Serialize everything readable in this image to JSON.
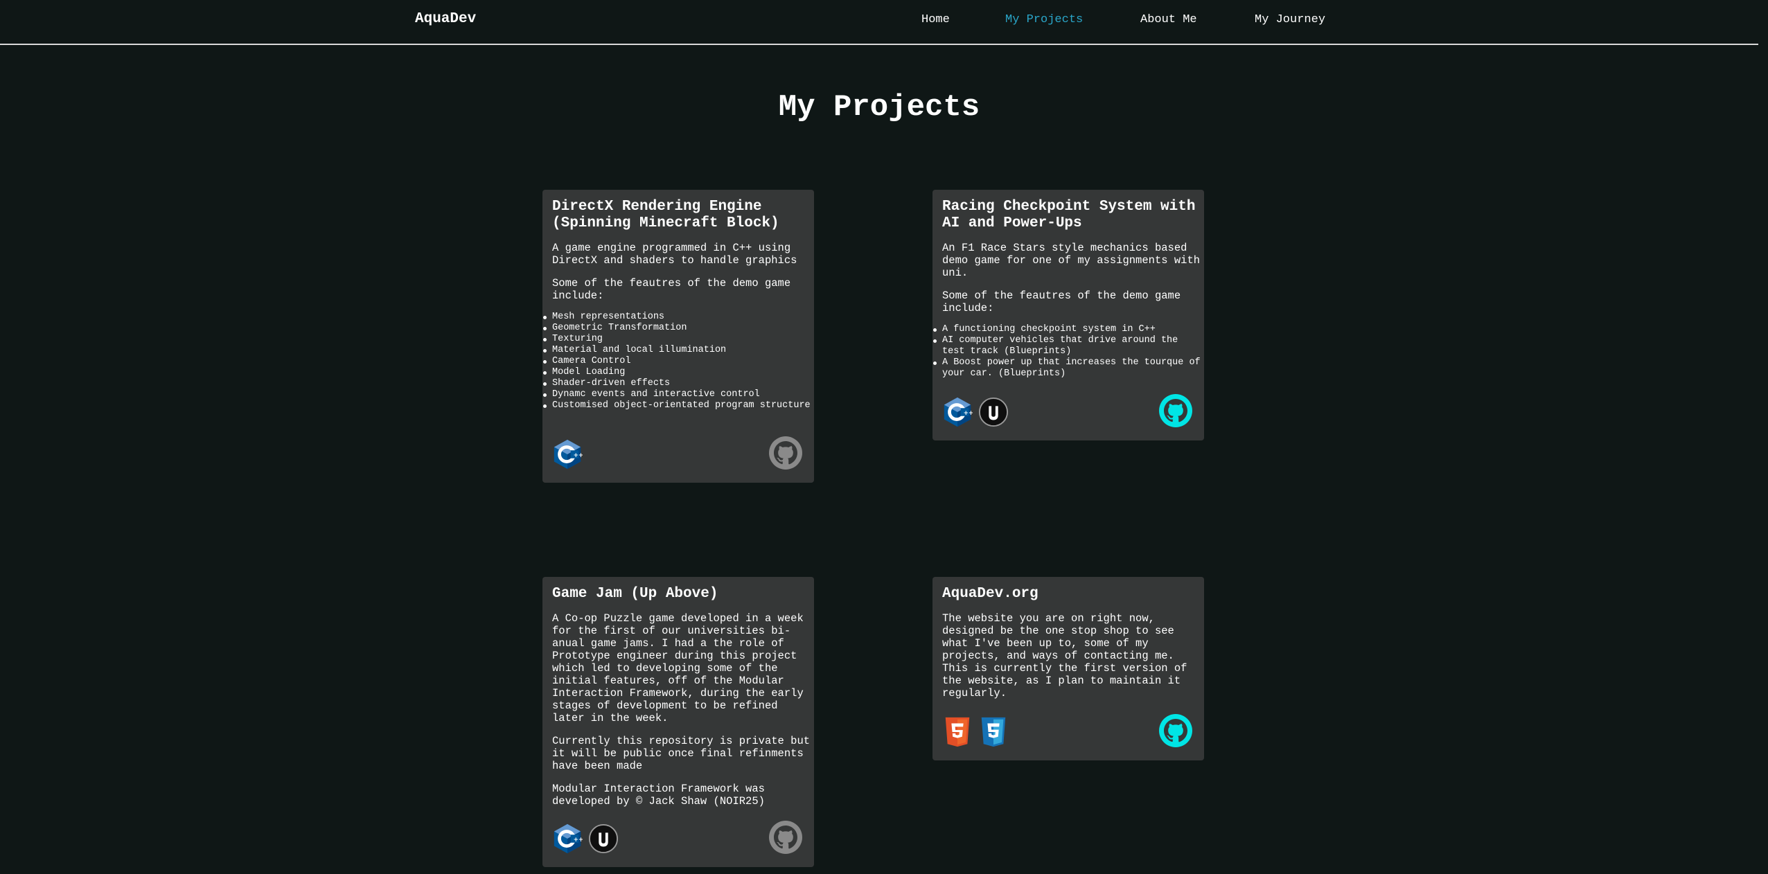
{
  "nav": {
    "brand": "AquaDev",
    "links": [
      {
        "label": "Home",
        "active": false
      },
      {
        "label": "My Projects",
        "active": true
      },
      {
        "label": "About Me",
        "active": false
      },
      {
        "label": "My Journey",
        "active": false
      }
    ]
  },
  "page_title": "My Projects",
  "colors": {
    "background": "#0f1716",
    "card": "#353737",
    "accent": "#2aa6c9",
    "github_active": "#00e5e5",
    "github_inactive": "#8a8a8a"
  },
  "projects": [
    {
      "title": "DirectX Rendering Engine (Spinning Minecraft Block)",
      "paragraphs": [
        "A game engine programmed in C++ using DirectX and shaders to handle graphics",
        "Some of the feautres of the demo game include:"
      ],
      "features": [
        "Mesh representations",
        "Geometric Transformation",
        "Texturing",
        "Material and local illumination",
        "Camera Control",
        "Model Loading",
        "Shader-driven effects",
        "Dynamc events and interactive control",
        "Customised object-orientated program structure"
      ],
      "tech": [
        "cpp-icon"
      ],
      "github": "github-icon-inactive"
    },
    {
      "title": "Racing Checkpoint System with AI and Power-Ups",
      "paragraphs": [
        "An F1 Race Stars style mechanics based demo game for one of my assignments with uni.",
        "Some of the feautres of the demo game include:"
      ],
      "features": [
        "A functioning checkpoint system in C++",
        "AI computer vehicles that drive around the test track (Blueprints)",
        "A Boost power up that increases the tourque of your car. (Blueprints)"
      ],
      "tech": [
        "cpp-icon",
        "unreal-icon"
      ],
      "github": "github-icon-active"
    },
    {
      "title": "Game Jam (Up Above)",
      "paragraphs": [
        "A Co-op Puzzle game developed in a week for the first of our universities bi-anual game jams. I had a the role of Prototype engineer during this project which led to developing some of the initial features, off of the Modular Interaction Framework, during the early stages of development to be refined later in the week.",
        "Currently this repository is private but it will be public once final refinments have been made",
        "Modular Interaction Framework was developed by © Jack Shaw (NOIR25)"
      ],
      "features": [],
      "tech": [
        "cpp-icon",
        "unreal-icon"
      ],
      "github": "github-icon-inactive"
    },
    {
      "title": "AquaDev.org",
      "paragraphs": [
        "The website you are on right now, designed be the one stop shop to see what I've been up to, some of my projects, and ways of contacting me. This is currently the first version of the website, as I plan to maintain it regularly."
      ],
      "features": [],
      "tech": [
        "html5-icon",
        "css3-icon"
      ],
      "github": "github-icon-active"
    }
  ]
}
